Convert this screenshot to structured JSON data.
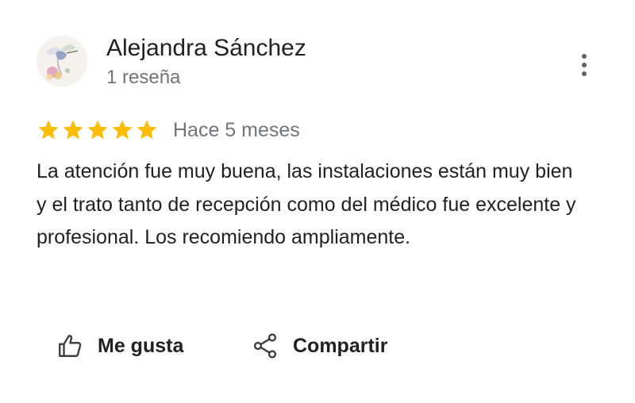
{
  "review": {
    "author": {
      "name": "Alejandra Sánchez",
      "meta": "1 reseña"
    },
    "rating": 5,
    "date": "Hace 5 meses",
    "text": "La atención fue muy buena, las instalaciones están muy bien y el trato tanto de recepción como del médico fue excelente y profesional. Los recomiendo ampliamente."
  },
  "actions": {
    "like_label": "Me gusta",
    "share_label": "Compartir"
  },
  "icons": {
    "more": "more-vert-icon",
    "like": "thumb-up-icon",
    "share": "share-icon",
    "star": "star-icon"
  },
  "colors": {
    "star": "#FBBC04",
    "primary_text": "#202124",
    "secondary_text": "#70757A",
    "icon": "#3C4043"
  }
}
